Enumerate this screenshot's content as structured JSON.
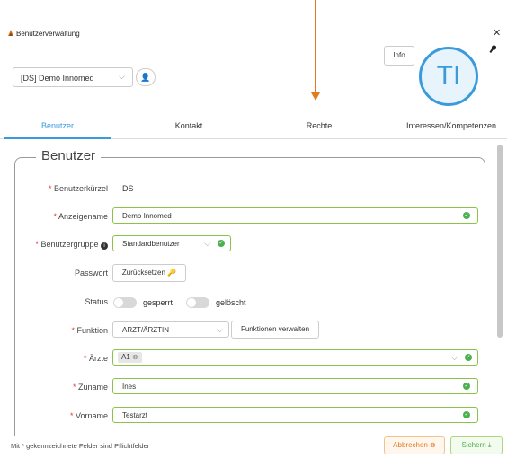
{
  "window": {
    "title": "Benutzerverwaltung",
    "close_glyph": "✕"
  },
  "header": {
    "user_select_value": "[DS] Demo Innomed",
    "info_label": "Info",
    "avatar_initials": "TI",
    "key_glyph": "🔑"
  },
  "tabs": [
    {
      "label": "Benutzer",
      "active": true
    },
    {
      "label": "Kontakt",
      "active": false
    },
    {
      "label": "Rechte",
      "active": false
    },
    {
      "label": "Interessen/Kompetenzen",
      "active": false
    }
  ],
  "section": {
    "legend": "Benutzer"
  },
  "fields": {
    "kuerzel": {
      "label": "Benutzerkürzel",
      "value": "DS"
    },
    "anzeigename": {
      "label": "Anzeigename",
      "value": "Demo Innomed"
    },
    "gruppe": {
      "label": "Benutzergruppe",
      "value": "Standardbenutzer"
    },
    "passwort": {
      "label": "Passwort",
      "button": "Zurücksetzen"
    },
    "status": {
      "label": "Status",
      "toggle1": "gesperrt",
      "toggle2": "gelöscht"
    },
    "funktion": {
      "label": "Funktion",
      "value": "ARZT/ÄRZTIN",
      "button": "Funktionen verwalten"
    },
    "aerzte": {
      "label": "Ärzte",
      "tag": "A1"
    },
    "zuname": {
      "label": "Zuname",
      "value": "Ines"
    },
    "vorname": {
      "label": "Vorname",
      "value": "Testarzt"
    }
  },
  "footer": {
    "note": "Mit * gekennzeichnete Felder sind Pflichtfelder",
    "cancel": "Abbrechen",
    "save": "Sichern"
  },
  "colors": {
    "accent": "#3a9bdc",
    "valid": "#4caf50",
    "cancel": "#e07b1f",
    "required": "#e53935"
  }
}
